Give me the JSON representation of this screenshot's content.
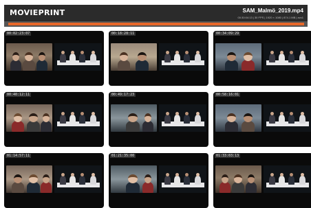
{
  "header": {
    "logo": "MOVIEPRINT",
    "file_title": "SAM_Malmö_2019.mp4",
    "file_meta": "00:30:04:13 | 30 FPS | 1920 × 1080 | 874.1 MB | avc1"
  },
  "thumbs": [
    {
      "timecode": "00:02:23:07",
      "scene": "a"
    },
    {
      "timecode": "00:18:28:11",
      "scene": "b"
    },
    {
      "timecode": "00:34:09:29",
      "scene": "c"
    },
    {
      "timecode": "00:40:12:11",
      "scene": "d"
    },
    {
      "timecode": "00:49:17:23",
      "scene": "e"
    },
    {
      "timecode": "00:58:16:01",
      "scene": "c"
    },
    {
      "timecode": "01:14:57:11",
      "scene": "d"
    },
    {
      "timecode": "01:21:35:00",
      "scene": "e"
    },
    {
      "timecode": "01:33:03:13",
      "scene": "a"
    }
  ]
}
